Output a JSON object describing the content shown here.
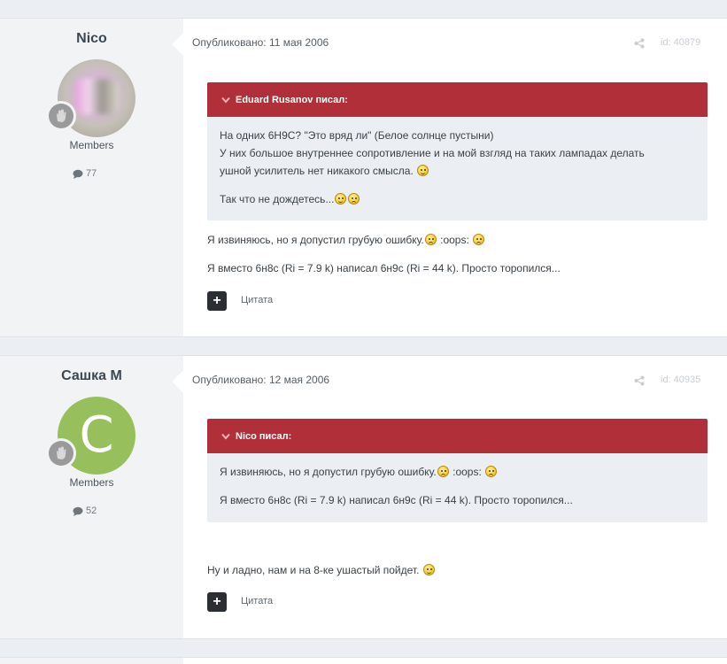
{
  "posts": [
    {
      "author": "Nico",
      "group": "Members",
      "post_count": "77",
      "published": "Опубликовано: 11 мая 2006",
      "post_id": "id: 40879",
      "quote": {
        "header": "Eduard Rusanov писал:",
        "line1": "На одних 6Н9С? \"Это вряд ли\" (Белое солнце пустыни)",
        "line2": "У них большое внутреннее сопротивление и на мой взгляд на таких лампадах делать",
        "line3": "ушной усилитель нет никакого смысла.",
        "line4": "Так что не дождетесь..."
      },
      "text1": "Я извиняюсь, но я допустил грубую ошибку.",
      "text1_code": ":oops:",
      "text2": "Я вместо 6н8с (Ri = 7.9 k) написал 6н9с (Ri = 44 k). Просто торопился...",
      "quote_action": "Цитата"
    },
    {
      "author": "Сашка М",
      "avatar_letter": "C",
      "group": "Members",
      "post_count": "52",
      "published": "Опубликовано: 12 мая 2006",
      "post_id": "id: 40935",
      "quote": {
        "header": "Nico писал:",
        "line1": "Я извиняюсь, но я допустил грубую ошибку.",
        "line1_code": ":oops:",
        "line2": "Я вместо 6н8с (Ri = 7.9 k) написал 6н9с (Ri = 44 k). Просто торопился..."
      },
      "text1": "Ну и ладно, нам и на 8-ке ушастый пойдет.",
      "quote_action": "Цитата"
    }
  ],
  "colors": {
    "quote_header": "#b02f38",
    "quote_body": "#ebeff3",
    "author_panel": "#f2f3f5",
    "page_bg": "#ebeef2",
    "avatar_green": "#97c05c"
  },
  "icons": {
    "comment": "comment-icon",
    "share": "share-icon",
    "chevron": "chevron-down-icon",
    "plus": "plus-icon",
    "badge": "hand-badge-icon"
  }
}
